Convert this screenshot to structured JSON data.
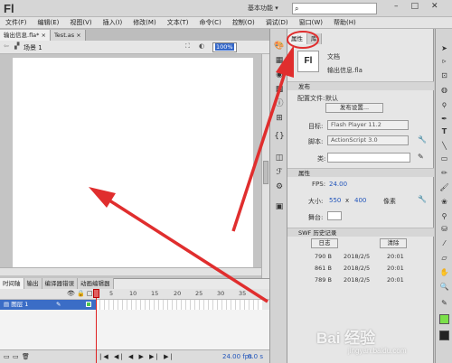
{
  "app": {
    "logo": "Fl",
    "workspace": "基本功能 ▾"
  },
  "menu": [
    "文件(F)",
    "编辑(E)",
    "视图(V)",
    "插入(I)",
    "修改(M)",
    "文本(T)",
    "命令(C)",
    "控制(O)",
    "调试(D)",
    "窗口(W)",
    "帮助(H)"
  ],
  "doc_tabs": [
    {
      "label": "输出信息.fla*"
    },
    {
      "label": "Test.as"
    }
  ],
  "edit_bar": {
    "scene": "场景 1",
    "zoom": "100%"
  },
  "timeline": {
    "tabs": [
      "时间轴",
      "输出",
      "编译器错误",
      "动画编辑器"
    ],
    "frame_numbers": [
      "5",
      "10",
      "15",
      "20",
      "25",
      "30",
      "35"
    ],
    "layer_name": "图层 1",
    "fps": "24.00 fps",
    "time": "0.0 s"
  },
  "properties": {
    "tabs": [
      "属性",
      "库"
    ],
    "doc_icon": "Fl",
    "doc_type": "文档",
    "doc_name": "输出信息.fla",
    "publish": {
      "section": "发布",
      "config_label": "配置文件:",
      "config_value": "默认",
      "publish_settings": "发布设置...",
      "target_label": "目标:",
      "target_value": "Flash Player 11.2",
      "script_label": "脚本:",
      "script_value": "ActionScript 3.0",
      "class_label": "类:"
    },
    "props": {
      "section": "属性",
      "fps_label": "FPS:",
      "fps_value": "24.00",
      "size_label": "大小:",
      "width": "550",
      "x": "x",
      "height": "400",
      "unit": "像素",
      "stage_label": "舞台:"
    },
    "swf_history": {
      "section": "SWF 历史记录",
      "log_button": "日志",
      "clear_button": "清除",
      "rows": [
        {
          "size": "790 B",
          "date": "2018/2/5",
          "time": "20:01"
        },
        {
          "size": "861 B",
          "date": "2018/2/5",
          "time": "20:01"
        },
        {
          "size": "789 B",
          "date": "2018/2/5",
          "time": "20:01"
        }
      ]
    }
  },
  "watermark": {
    "brand": "Bai 经验",
    "url": "jingyan.baidu.com"
  },
  "colors": {
    "annotation": "#e02e2e",
    "selection": "#3b6dc6"
  }
}
